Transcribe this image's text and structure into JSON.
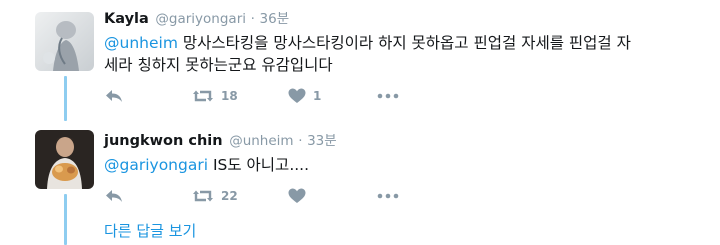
{
  "tweets": [
    {
      "name": "Kayla",
      "handle": "@gariyongari",
      "separator": "·",
      "time": "36분",
      "mention": "@unheim",
      "text_line1": " 망사스타킹을 망사스타킹이라 하지 못하옵고 핀업걸 자세를 핀업걸 자",
      "text_line2": "세라 칭하지 못하는군요 유감입니다",
      "retweets": "18",
      "likes": "1",
      "icons": {
        "reply": "reply-icon",
        "retweet": "retweet-icon",
        "like": "heart-icon",
        "more": "more-icon"
      }
    },
    {
      "name": "jungkwon chin",
      "handle": "@unheim",
      "separator": "·",
      "time": "33분",
      "mention": "@gariyongari",
      "text": " IS도 아니고....",
      "retweets": "22",
      "likes": "",
      "icons": {
        "reply": "reply-icon",
        "retweet": "retweet-icon",
        "like": "heart-icon",
        "more": "more-icon"
      }
    }
  ],
  "more_replies_label": "다른 답글 보기",
  "colors": {
    "link": "#1b95e0",
    "muted": "#8899a6",
    "thread_line": "#8ecdf0",
    "text": "#14171a"
  }
}
